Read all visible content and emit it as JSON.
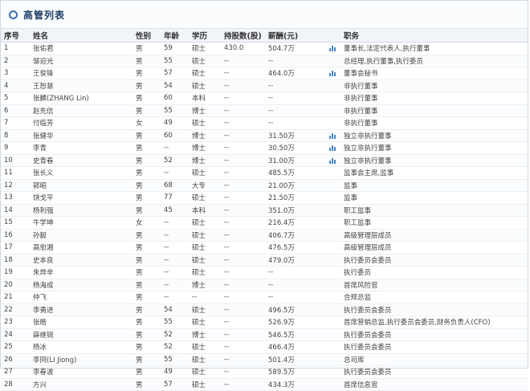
{
  "title": "高管列表",
  "headers": [
    "序号",
    "姓名",
    "性别",
    "年龄",
    "学历",
    "持股数(股)",
    "薪酬(元)",
    "职务"
  ],
  "rows": [
    {
      "no": "1",
      "name": "张佑君",
      "gender": "男",
      "age": "59",
      "edu": "硕士",
      "shares": "430.0",
      "salary": "504.7万",
      "chart": true,
      "title": "董事长,法定代表人,执行董事"
    },
    {
      "no": "2",
      "name": "邹迎光",
      "gender": "男",
      "age": "55",
      "edu": "硕士",
      "shares": "--",
      "salary": "--",
      "chart": false,
      "title": "总经理,执行董事,执行委员"
    },
    {
      "no": "3",
      "name": "王俊锋",
      "gender": "男",
      "age": "57",
      "edu": "硕士",
      "shares": "--",
      "salary": "464.0万",
      "chart": true,
      "title": "董事会秘书"
    },
    {
      "no": "4",
      "name": "王恕慧",
      "gender": "男",
      "age": "54",
      "edu": "硕士",
      "shares": "--",
      "salary": "--",
      "chart": false,
      "title": "非执行董事"
    },
    {
      "no": "5",
      "name": "张麟(ZHANG Lin)",
      "gender": "男",
      "age": "60",
      "edu": "本科",
      "shares": "--",
      "salary": "--",
      "chart": false,
      "title": "非执行董事"
    },
    {
      "no": "6",
      "name": "赵先信",
      "gender": "男",
      "age": "55",
      "edu": "博士",
      "shares": "--",
      "salary": "--",
      "chart": false,
      "title": "非执行董事"
    },
    {
      "no": "7",
      "name": "付临芳",
      "gender": "女",
      "age": "49",
      "edu": "硕士",
      "shares": "--",
      "salary": "--",
      "chart": false,
      "title": "非执行董事"
    },
    {
      "no": "8",
      "name": "张健华",
      "gender": "男",
      "age": "60",
      "edu": "博士",
      "shares": "--",
      "salary": "31.50万",
      "chart": true,
      "title": "独立非执行董事"
    },
    {
      "no": "9",
      "name": "李青",
      "gender": "男",
      "age": "--",
      "edu": "博士",
      "shares": "--",
      "salary": "30.50万",
      "chart": true,
      "title": "独立非执行董事"
    },
    {
      "no": "10",
      "name": "史青春",
      "gender": "男",
      "age": "52",
      "edu": "博士",
      "shares": "--",
      "salary": "31.00万",
      "chart": true,
      "title": "独立非执行董事"
    },
    {
      "no": "11",
      "name": "张长义",
      "gender": "男",
      "age": "--",
      "edu": "硕士",
      "shares": "--",
      "salary": "485.5万",
      "chart": false,
      "title": "监事会主席,监事"
    },
    {
      "no": "12",
      "name": "郭昭",
      "gender": "男",
      "age": "68",
      "edu": "大专",
      "shares": "--",
      "salary": "21.00万",
      "chart": false,
      "title": "监事"
    },
    {
      "no": "13",
      "name": "饶戈平",
      "gender": "男",
      "age": "77",
      "edu": "硕士",
      "shares": "--",
      "salary": "21.50万",
      "chart": false,
      "title": "监事"
    },
    {
      "no": "14",
      "name": "杨利强",
      "gender": "男",
      "age": "45",
      "edu": "本科",
      "shares": "--",
      "salary": "351.0万",
      "chart": false,
      "title": "职工监事"
    },
    {
      "no": "15",
      "name": "牛学坤",
      "gender": "女",
      "age": "--",
      "edu": "硕士",
      "shares": "--",
      "salary": "216.4万",
      "chart": false,
      "title": "职工监事"
    },
    {
      "no": "16",
      "name": "孙毅",
      "gender": "男",
      "age": "--",
      "edu": "硕士",
      "shares": "--",
      "salary": "406.7万",
      "chart": false,
      "title": "高级管理层成员"
    },
    {
      "no": "17",
      "name": "高愈湘",
      "gender": "男",
      "age": "--",
      "edu": "硕士",
      "shares": "--",
      "salary": "476.5万",
      "chart": false,
      "title": "高级管理层成员"
    },
    {
      "no": "18",
      "name": "史本良",
      "gender": "男",
      "age": "--",
      "edu": "硕士",
      "shares": "--",
      "salary": "479.0万",
      "chart": false,
      "title": "执行委员会委员"
    },
    {
      "no": "19",
      "name": "朱烨辛",
      "gender": "男",
      "age": "--",
      "edu": "硕士",
      "shares": "--",
      "salary": "--",
      "chart": false,
      "title": "执行委员"
    },
    {
      "no": "20",
      "name": "杨海成",
      "gender": "男",
      "age": "--",
      "edu": "博士",
      "shares": "--",
      "salary": "--",
      "chart": false,
      "title": "首席风险官"
    },
    {
      "no": "21",
      "name": "仲飞",
      "gender": "男",
      "age": "--",
      "edu": "--",
      "shares": "--",
      "salary": "--",
      "chart": false,
      "title": "合规总监"
    },
    {
      "no": "22",
      "name": "李勇进",
      "gender": "男",
      "age": "54",
      "edu": "硕士",
      "shares": "--",
      "salary": "496.5万",
      "chart": false,
      "title": "执行委员会委员"
    },
    {
      "no": "23",
      "name": "张皓",
      "gender": "男",
      "age": "55",
      "edu": "硕士",
      "shares": "--",
      "salary": "526.9万",
      "chart": false,
      "title": "首席营销总监,执行委员会委员,财务负责人(CFO)"
    },
    {
      "no": "24",
      "name": "薛继锐",
      "gender": "男",
      "age": "52",
      "edu": "博士",
      "shares": "--",
      "salary": "546.5万",
      "chart": false,
      "title": "执行委员会委员"
    },
    {
      "no": "25",
      "name": "杨冰",
      "gender": "男",
      "age": "52",
      "edu": "硕士",
      "shares": "--",
      "salary": "466.4万",
      "chart": false,
      "title": "执行委员会委员"
    },
    {
      "no": "26",
      "name": "李冏(LI Jiong)",
      "gender": "男",
      "age": "55",
      "edu": "硕士",
      "shares": "--",
      "salary": "501.4万",
      "chart": false,
      "title": "总司库"
    },
    {
      "no": "27",
      "name": "李春波",
      "gender": "男",
      "age": "49",
      "edu": "硕士",
      "shares": "--",
      "salary": "589.5万",
      "chart": false,
      "title": "执行委员会委员"
    },
    {
      "no": "28",
      "name": "方兴",
      "gender": "男",
      "age": "57",
      "edu": "硕士",
      "shares": "--",
      "salary": "434.3万",
      "chart": false,
      "title": "首席信息官"
    }
  ]
}
